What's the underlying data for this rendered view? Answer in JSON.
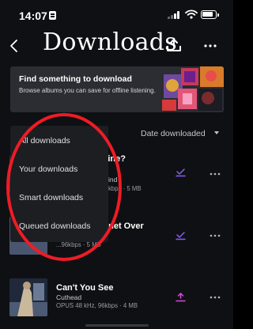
{
  "status_bar": {
    "time": "14:07",
    "icons": [
      "id-card-icon",
      "signal-icon",
      "wifi-icon",
      "battery-icon"
    ]
  },
  "header": {
    "title": "Downloads",
    "back_icon": "chevron-left-icon",
    "upload_icon": "upload-icon",
    "more_icon": "more-horizontal-icon"
  },
  "promo": {
    "title": "Find something to download",
    "description": "Browse albums you can save for offline listening."
  },
  "sort": {
    "label": "Date downloaded",
    "caret_icon": "caret-down-icon"
  },
  "dropdown": {
    "items": [
      "All downloads",
      "Your downloads",
      "Smart downloads",
      "Queued downloads"
    ]
  },
  "list": {
    "rows": [
      {
        "title_fragment": "Shrine?",
        "artist_fragment": "ind",
        "meta_fragment": "kbps · 5 MB",
        "status_icon": "downloaded-check-icon"
      },
      {
        "title_fragment": "anet Over",
        "artist_fragment": "",
        "meta_fragment": "...96kbps · 5 MB",
        "status_icon": "downloaded-check-icon"
      },
      {
        "title": "Can't You See",
        "artist": "Cuthead",
        "meta": "OPUS 48 kHz, 96kbps · 4 MB",
        "status_icon": "download-pending-icon"
      }
    ]
  },
  "colors": {
    "background": "#0f1013",
    "accent_purple": "#8a5cf6",
    "accent_pink": "#d24dd6",
    "annotation_red": "#ee1c25"
  }
}
